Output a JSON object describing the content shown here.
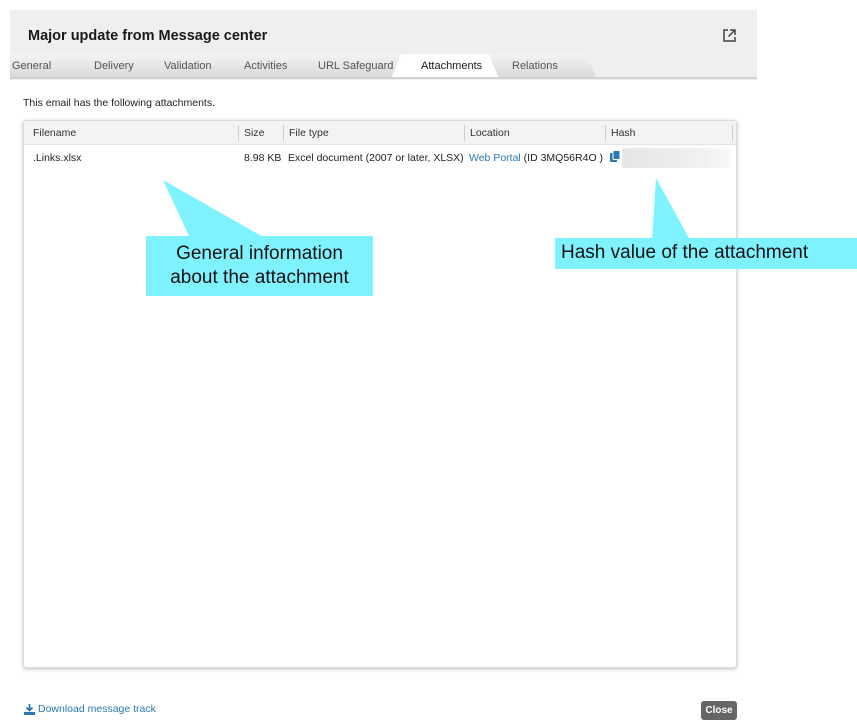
{
  "dialog": {
    "title": "Major update from Message center"
  },
  "tabs": [
    {
      "label": "General",
      "active": false
    },
    {
      "label": "Delivery",
      "active": false
    },
    {
      "label": "Validation",
      "active": false
    },
    {
      "label": "Activities",
      "active": false
    },
    {
      "label": "URL Safeguard",
      "active": false
    },
    {
      "label": "Attachments",
      "active": true
    },
    {
      "label": "Relations",
      "active": false
    }
  ],
  "intro": "This email has the following attachments.",
  "table": {
    "columns": [
      "Filename",
      "Size",
      "File type",
      "Location",
      "Hash"
    ],
    "rows": [
      {
        "filename": ".Links.xlsx",
        "size": "8.98 KB",
        "file_type": "Excel document (2007 or later, XLSX)",
        "location_link": "Web Portal",
        "location_suffix": "(ID 3MQ56R4O )",
        "hash": ""
      }
    ]
  },
  "callouts": {
    "general_line1": "General information",
    "general_line2": "about the attachment",
    "hash": "Hash value of the attachment"
  },
  "footer": {
    "download_label": "Download message track",
    "close_label": "Close"
  },
  "icons": {
    "popout": "external-link-icon",
    "copy": "copy-icon",
    "download": "download-icon"
  },
  "colors": {
    "link": "#2a79b6",
    "callout": "#7ff2ff",
    "close_button": "#666666"
  }
}
